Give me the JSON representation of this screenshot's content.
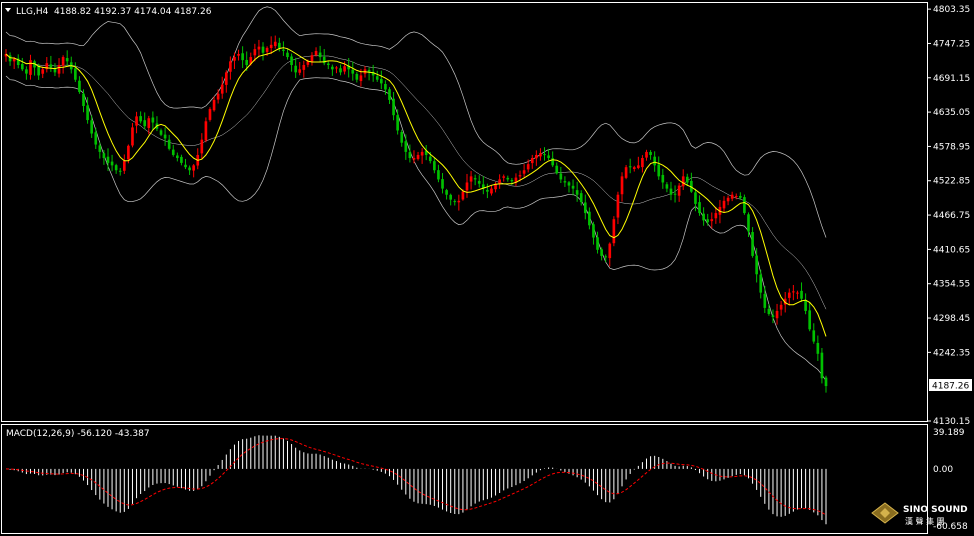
{
  "colors": {
    "background": "#000000",
    "frame": "#ffffff",
    "bull": "#ff0000",
    "bear": "#00c000",
    "ma": "#ffff00",
    "bands": "#c8c8c8",
    "macd_hist": "#ffffff",
    "macd_signal": "#ff0000",
    "price_tag_bg": "#ffffff",
    "price_tag_fg": "#000000"
  },
  "header": {
    "symbol": "LLG,H4",
    "ohlc": "4188.82 4192.37 4174.04 4187.26"
  },
  "price_axis": {
    "ticks": [
      "4803.35",
      "4747.25",
      "4691.15",
      "4635.05",
      "4578.95",
      "4522.85",
      "4466.75",
      "4410.65",
      "4354.55",
      "4298.45",
      "4242.35",
      "4130.15"
    ],
    "current": "4187.26"
  },
  "macd": {
    "label": "MACD(12,26,9) -56.120 -43.387",
    "ticks": [
      "39.189",
      "0.00",
      "-60.658"
    ]
  },
  "logo": {
    "brand": "SINO SOUND",
    "chinese": "漢 聲 集 團"
  },
  "chart_data": {
    "type": "candlestick",
    "symbol": "LLG",
    "timeframe": "H4",
    "ylim": [
      4130.15,
      4815
    ],
    "grid": false,
    "indicators": [
      "moving average",
      "bollinger bands",
      "MACD(12,26,9)"
    ],
    "closes": [
      4730,
      4718,
      4722,
      4712,
      4705,
      4698,
      4720,
      4708,
      4695,
      4705,
      4715,
      4708,
      4700,
      4712,
      4725,
      4718,
      4705,
      4688,
      4668,
      4645,
      4622,
      4600,
      4582,
      4570,
      4560,
      4552,
      4548,
      4540,
      4538,
      4555,
      4580,
      4610,
      4628,
      4620,
      4612,
      4625,
      4618,
      4608,
      4598,
      4592,
      4575,
      4565,
      4560,
      4552,
      4545,
      4540,
      4548,
      4565,
      4590,
      4620,
      4640,
      4655,
      4665,
      4680,
      4700,
      4718,
      4725,
      4730,
      4720,
      4712,
      4725,
      4738,
      4742,
      4732,
      4740,
      4745,
      4750,
      4740,
      4735,
      4725,
      4712,
      4700,
      4705,
      4712,
      4718,
      4728,
      4735,
      4725,
      4715,
      4712,
      4705,
      4708,
      4700,
      4710,
      4705,
      4698,
      4688,
      4695,
      4705,
      4700,
      4695,
      4688,
      4682,
      4672,
      4655,
      4630,
      4605,
      4585,
      4570,
      4560,
      4560,
      4565,
      4570,
      4565,
      4555,
      4540,
      4525,
      4510,
      4500,
      4492,
      4488,
      4490,
      4505,
      4520,
      4530,
      4525,
      4518,
      4510,
      4505,
      4510,
      4518,
      4525,
      4530,
      4525,
      4522,
      4528,
      4532,
      4540,
      4550,
      4560,
      4565,
      4568,
      4566,
      4560,
      4548,
      4535,
      4525,
      4520,
      4515,
      4510,
      4500,
      4488,
      4470,
      4450,
      4430,
      4410,
      4400,
      4398,
      4420,
      4460,
      4500,
      4530,
      4545,
      4545,
      4545,
      4548,
      4560,
      4570,
      4565,
      4548,
      4530,
      4520,
      4510,
      4500,
      4500,
      4515,
      4530,
      4520,
      4505,
      4485,
      4470,
      4458,
      4455,
      4460,
      4470,
      4480,
      4490,
      4495,
      4500,
      4498,
      4495,
      4470,
      4440,
      4400,
      4370,
      4340,
      4315,
      4305,
      4300,
      4310,
      4320,
      4330,
      4340,
      4342,
      4340,
      4330,
      4310,
      4280,
      4260,
      4240,
      4200,
      4187.26
    ],
    "macd": {
      "fast": 12,
      "slow": 26,
      "signal": 9,
      "main_value": -56.12,
      "signal_value": -43.387,
      "range": [
        -60.658,
        39.189
      ]
    }
  }
}
